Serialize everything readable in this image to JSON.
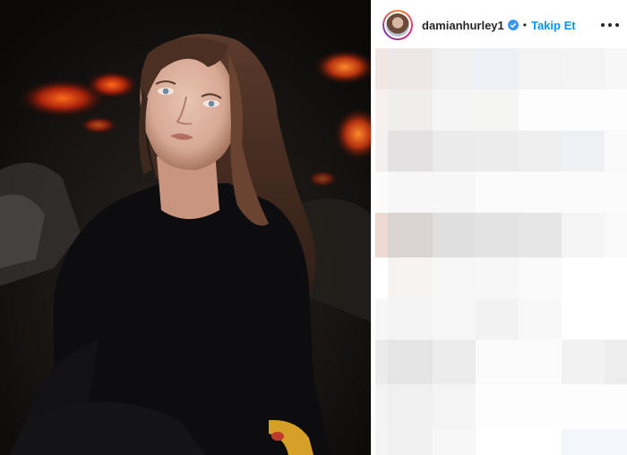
{
  "post": {
    "username": "damianhurley1",
    "follow_label": "Takip Et",
    "separator": "•"
  },
  "icons": {
    "verified": "verified-badge-icon",
    "more": "more-options-icon",
    "avatar": "profile-avatar"
  },
  "colors": {
    "follow": "#0095f6",
    "verified": "#3897f0",
    "text": "#262626"
  }
}
